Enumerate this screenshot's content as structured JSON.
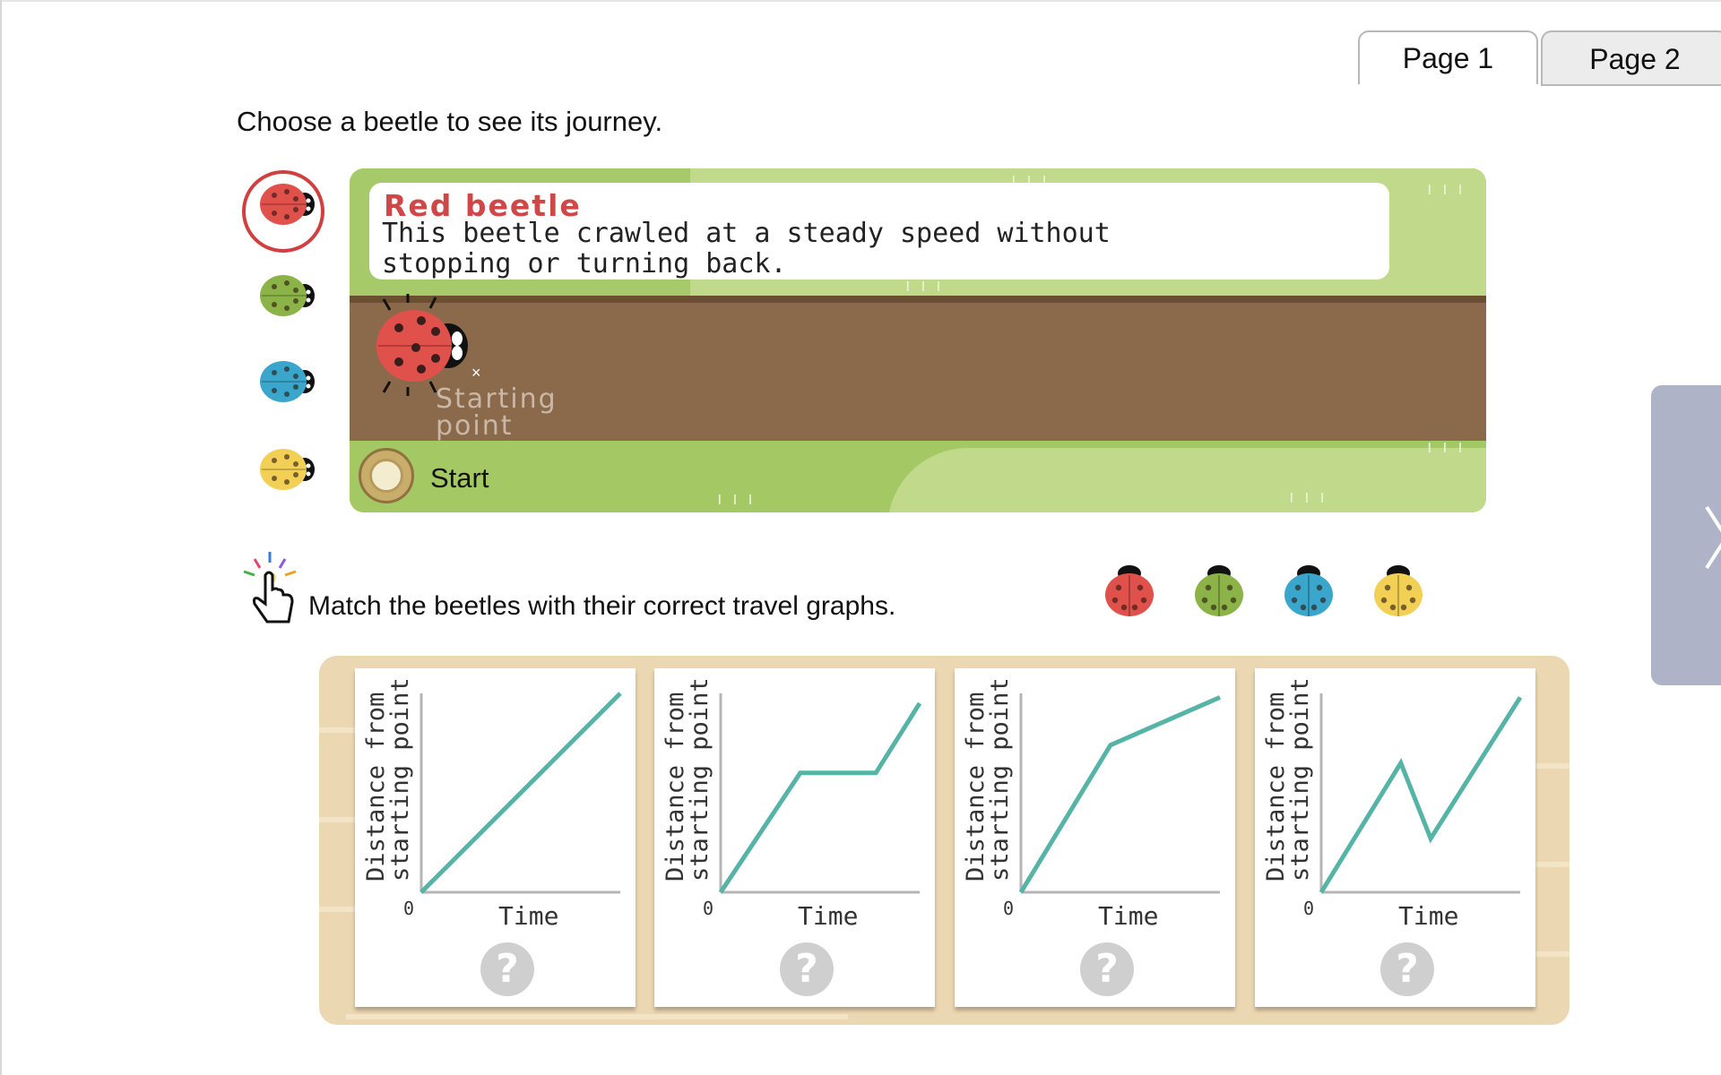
{
  "tabs": [
    {
      "label": "Page 1",
      "active": true
    },
    {
      "label": "Page 2",
      "active": false
    }
  ],
  "instruction": "Choose a beetle to see its journey.",
  "beetles": [
    {
      "name": "red",
      "color": "#e0514c",
      "selected": true
    },
    {
      "name": "green",
      "color": "#8cb348",
      "selected": false
    },
    {
      "name": "blue",
      "color": "#3aa6cc",
      "selected": false
    },
    {
      "name": "yellow",
      "color": "#f2d055",
      "selected": false
    }
  ],
  "scene": {
    "title": "Red beetle",
    "description": "This beetle crawled at a steady speed without stopping or turning back.",
    "start_label_line1": "Starting",
    "start_label_line2": "point",
    "start_marker": "×",
    "start_button": "Start"
  },
  "match_instruction": "Match the beetles with their correct travel graphs.",
  "graphs": {
    "y_label_line1": "Distance from",
    "y_label_line2": "starting point",
    "x_label": "Time",
    "origin": "0",
    "help": "?"
  },
  "chart_data": [
    {
      "type": "line",
      "xlabel": "Time",
      "ylabel": "Distance from starting point",
      "x": [
        0,
        1
      ],
      "y": [
        0,
        1
      ]
    },
    {
      "type": "line",
      "xlabel": "Time",
      "ylabel": "Distance from starting point",
      "x": [
        0,
        0.4,
        0.78,
        1
      ],
      "y": [
        0,
        0.6,
        0.6,
        0.95
      ]
    },
    {
      "type": "line",
      "xlabel": "Time",
      "ylabel": "Distance from starting point",
      "x": [
        0,
        0.45,
        1
      ],
      "y": [
        0,
        0.74,
        0.98
      ]
    },
    {
      "type": "line",
      "xlabel": "Time",
      "ylabel": "Distance from starting point",
      "x": [
        0,
        0.4,
        0.55,
        1
      ],
      "y": [
        0,
        0.65,
        0.27,
        0.98
      ]
    }
  ],
  "colors": {
    "line": "#55b4a6",
    "accent_red": "#d04747"
  }
}
